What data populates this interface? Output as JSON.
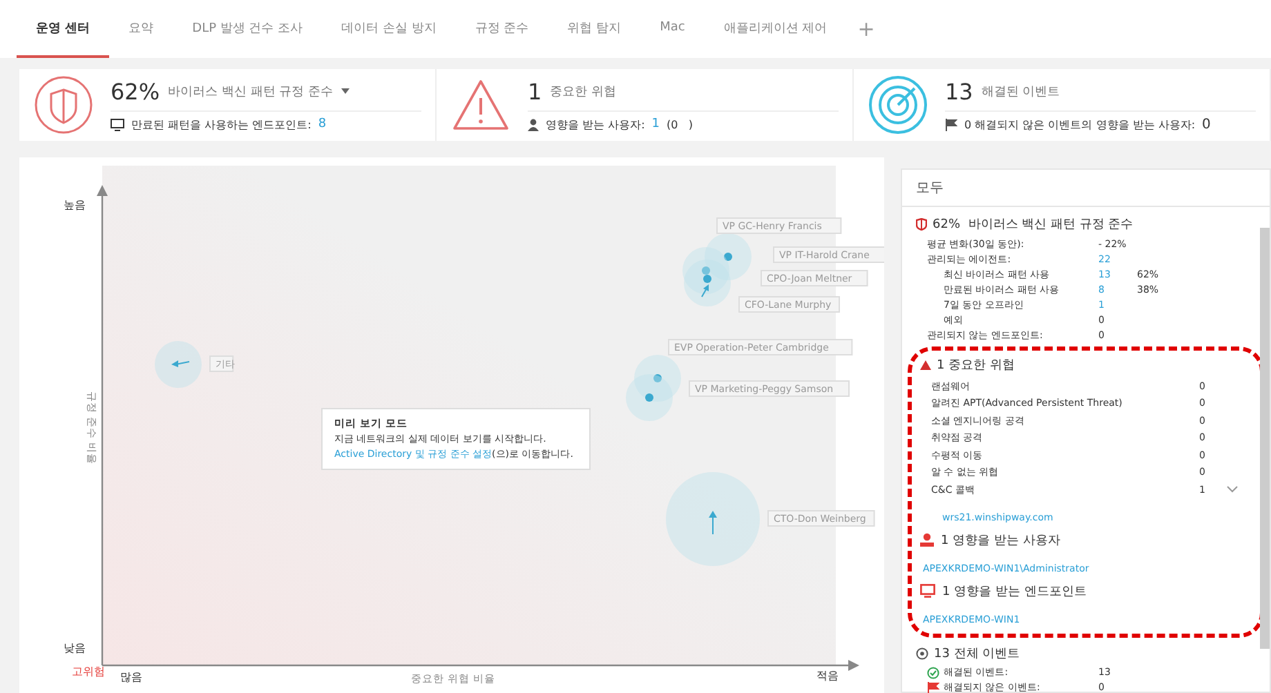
{
  "tabs": [
    {
      "label": "운영 센터",
      "selected": true
    },
    {
      "label": "요약",
      "selected": false
    },
    {
      "label": "DLP 발생 건수 조사",
      "selected": false
    },
    {
      "label": "데이터 손실 방지",
      "selected": false
    },
    {
      "label": "규정 준수",
      "selected": false
    },
    {
      "label": "위협 탐지",
      "selected": false
    },
    {
      "label": "Mac",
      "selected": false
    },
    {
      "label": "애플리케이션 제어",
      "selected": false
    }
  ],
  "add_tab": "+",
  "summary": [
    {
      "kind": "shield",
      "value": "62%",
      "label": "바이러스 백신 패턴 규정 준수",
      "dropdown": true,
      "sub_label": "만료된 패턴을 사용하는 엔드포인트:",
      "sub_value": "8"
    },
    {
      "kind": "warning",
      "value": "1",
      "label": "중요한 위협",
      "dropdown": false,
      "sub_label": "영향을 받는 사용자:",
      "sub_value": "1",
      "sub_extra": "(0   )"
    },
    {
      "kind": "radar",
      "value": "13",
      "label": "해결된 이벤트",
      "dropdown": false,
      "sub_label": "0 해결되지 않은 이벤트의 영향을 받는 사용자:",
      "sub_value": "0"
    }
  ],
  "chart": {
    "y_high": "높음",
    "y_low": "낮음",
    "y_label": "규정 준수 비율",
    "x_many": "많음",
    "x_label": "중요한 위협 비율",
    "x_few": "적음",
    "risk_label": "고위험",
    "bubbles": [
      {
        "label": "기타"
      },
      {
        "label": "VP GC-Henry Francis"
      },
      {
        "label": "VP IT-Harold Crane"
      },
      {
        "label": "CPO-Joan Meltner"
      },
      {
        "label": "CFO-Lane Murphy"
      },
      {
        "label": "EVP Operation-Peter Cambridge"
      },
      {
        "label": "VP Marketing-Peggy Samson"
      },
      {
        "label": "CTO-Don Weinberg"
      }
    ],
    "tooltip": {
      "title": "미리 보기 모드",
      "line": "지금 네트워크의 실제 데이터 보기를 시작합니다.",
      "link": "Active Directory 및 규정 준수 설정",
      "suffix": "(으)로 이동합니다."
    }
  },
  "panel": {
    "title": "모두",
    "compliance": {
      "value": "62%",
      "label": "바이러스 백신 패턴 규정 준수",
      "rows": [
        {
          "label": "평균 변화(30일 동안):",
          "value": "- 22%",
          "link": false,
          "indent": false,
          "percent": ""
        },
        {
          "label": "관리되는 에이전트:",
          "value": "22",
          "link": true,
          "indent": false,
          "percent": ""
        },
        {
          "label": "최신 바이러스 패턴 사용",
          "value": "13",
          "link": true,
          "indent": true,
          "percent": "62%"
        },
        {
          "label": "만료된 바이러스 패턴 사용",
          "value": "8",
          "link": true,
          "indent": true,
          "percent": "38%"
        },
        {
          "label": "7일 동안 오프라인",
          "value": "1",
          "link": true,
          "indent": true,
          "percent": ""
        },
        {
          "label": "예외",
          "value": "0",
          "link": false,
          "indent": true,
          "percent": ""
        },
        {
          "label": "관리되지 않는 엔드포인트:",
          "value": "0",
          "link": false,
          "indent": false,
          "percent": ""
        }
      ]
    },
    "threats": {
      "title": "1 중요한 위협",
      "rows": [
        {
          "label": "랜섬웨어",
          "value": "0",
          "expandable": false
        },
        {
          "label": "알려진 APT(Advanced Persistent Threat)",
          "value": "0",
          "expandable": false
        },
        {
          "label": "소셜 엔지니어링 공격",
          "value": "0",
          "expandable": false
        },
        {
          "label": "취약점 공격",
          "value": "0",
          "expandable": false
        },
        {
          "label": "수평적 이동",
          "value": "0",
          "expandable": false
        },
        {
          "label": "알 수 없는 위협",
          "value": "0",
          "expandable": false
        },
        {
          "label": "C&C 콜백",
          "value": "1",
          "expandable": true
        }
      ],
      "callback_link": "wrs21.winshipway.com",
      "users_title": "1 영향을 받는 사용자",
      "user_link": "APEXKRDEMO-WIN1\\Administrator",
      "endpoints_title": "1 영향을 받는 엔드포인트",
      "endpoint_link": "APEXKRDEMO-WIN1"
    },
    "events": {
      "title": "13 전체 이벤트",
      "rows": [
        {
          "kind": "resolved",
          "label": "해결된 이벤트:",
          "value": "13"
        },
        {
          "kind": "unresolved",
          "label": "해결되지 않은 이벤트:",
          "value": "0"
        }
      ]
    }
  }
}
